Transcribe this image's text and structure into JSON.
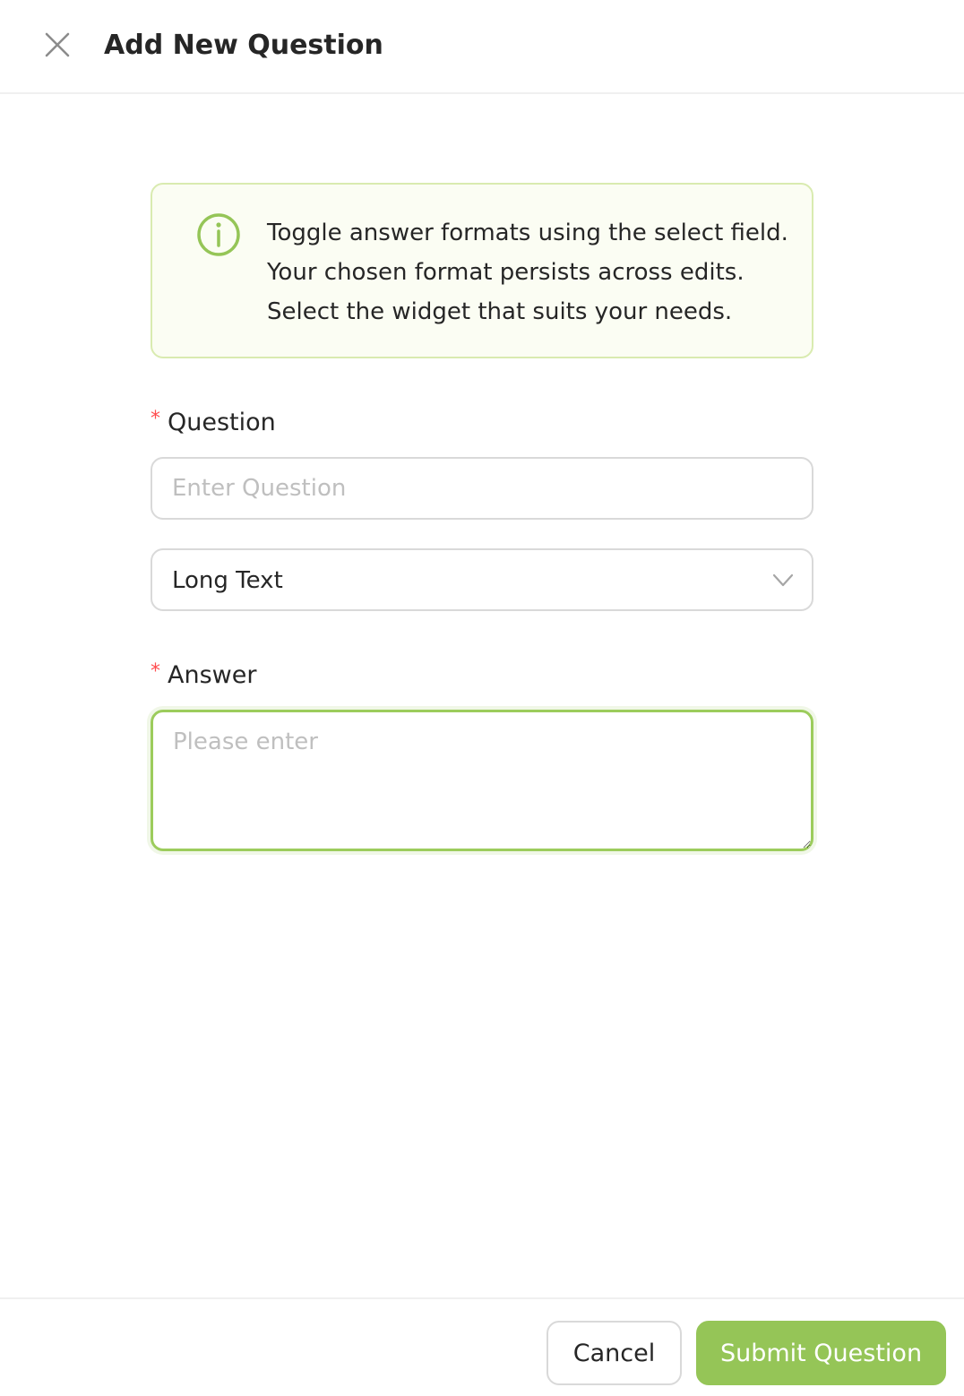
{
  "header": {
    "title": "Add New Question",
    "close_icon": "close-icon"
  },
  "alert": {
    "icon": "info-circle-icon",
    "lines": [
      "Toggle answer formats using the select field.",
      "Your chosen format persists across edits.",
      "Select the widget that suits your needs."
    ]
  },
  "form": {
    "question": {
      "required_mark": "*",
      "label": "Question",
      "value": "",
      "placeholder": "Enter Question"
    },
    "format_select": {
      "selected": "Long Text",
      "icon": "chevron-down-icon"
    },
    "answer": {
      "required_mark": "*",
      "label": "Answer",
      "value": "",
      "placeholder": "Please enter"
    }
  },
  "footer": {
    "cancel_label": "Cancel",
    "submit_label": "Submit Question"
  },
  "colors": {
    "accent": "#95c557",
    "alert_background": "#fbfdf3",
    "alert_border": "#d9ebb0",
    "required": "#ff4d4f"
  }
}
